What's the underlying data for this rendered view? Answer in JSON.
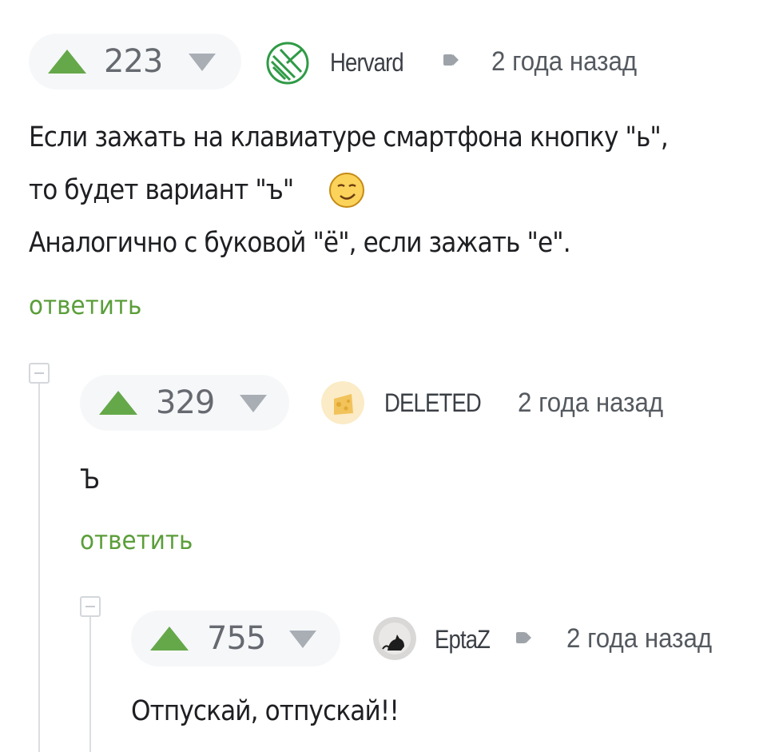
{
  "comments": [
    {
      "rating": "223",
      "username": "Hervard",
      "time": "2 года назад",
      "body": [
        "Если зажать на клавиатуре смартфона кнопку \"ь\",",
        "то будет вариант \"ъ\"",
        "Аналогично с буковой \"ё\", если зажать \"е\"."
      ],
      "emoji": "smirk-emoji",
      "reply": "ответить",
      "avatar": "leaf-logo-icon"
    },
    {
      "rating": "329",
      "username": "DELETED",
      "time": "2 года назад",
      "body": [
        "Ъ"
      ],
      "reply": "ответить",
      "avatar": "deleted-avatar"
    },
    {
      "rating": "755",
      "username": "EptaZ",
      "time": "2 года назад",
      "body": [
        "Отпускай, отпускай!!"
      ],
      "avatar": "cat-avatar"
    }
  ],
  "colors": {
    "upvote": "#65a84a",
    "downvote": "#a9aeb5",
    "reply_link": "#5b9e3a",
    "pill_bg": "#f6f7f9"
  }
}
